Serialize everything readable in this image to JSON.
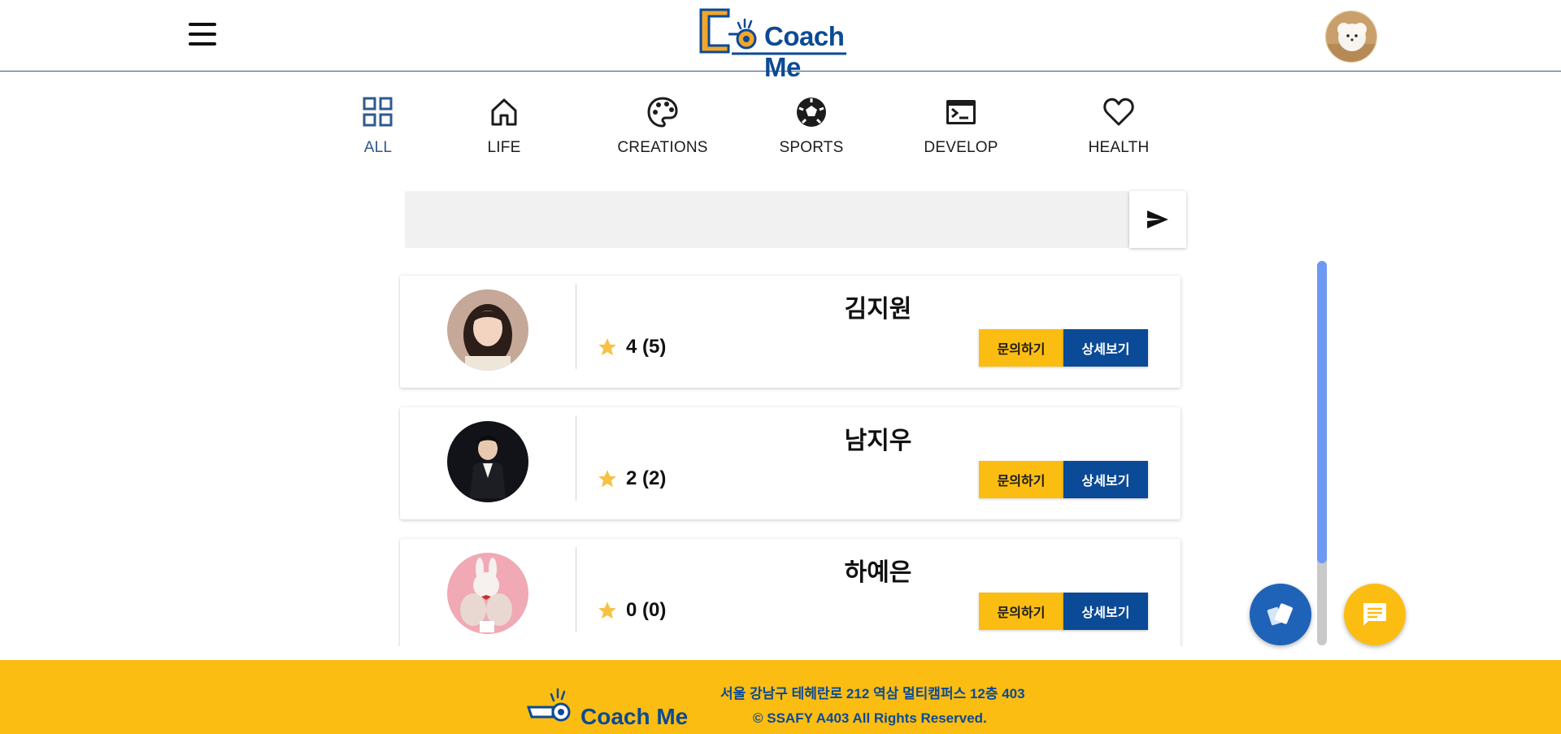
{
  "app": {
    "brand": "Coach Me",
    "logo_icon": "whistle-icon",
    "accent_color": "#0b4a96",
    "highlight_color": "#fbbd12"
  },
  "header": {
    "menu_icon": "hamburger-menu-icon",
    "profile_avatar": "user-avatar"
  },
  "categories": [
    {
      "label": "ALL",
      "icon": "grid-icon",
      "active": true
    },
    {
      "label": "LIFE",
      "icon": "home-icon",
      "active": false
    },
    {
      "label": "CREATIONS",
      "icon": "palette-icon",
      "active": false
    },
    {
      "label": "SPORTS",
      "icon": "soccer-ball-icon",
      "active": false
    },
    {
      "label": "DEVELOP",
      "icon": "terminal-icon",
      "active": false
    },
    {
      "label": "HEALTH",
      "icon": "heart-icon",
      "active": false
    }
  ],
  "search": {
    "value": "",
    "placeholder": "",
    "send_icon": "send-icon"
  },
  "coaches": [
    {
      "name": "김지원",
      "rating_text": "4 (5)",
      "inquiry_label": "문의하기",
      "detail_label": "상세보기"
    },
    {
      "name": "남지우",
      "rating_text": "2 (2)",
      "inquiry_label": "문의하기",
      "detail_label": "상세보기"
    },
    {
      "name": "하예은",
      "rating_text": "0 (0)",
      "inquiry_label": "문의하기",
      "detail_label": "상세보기"
    }
  ],
  "fabs": {
    "cards_icon": "cards-icon",
    "chat_icon": "chat-icon"
  },
  "footer": {
    "brand": "Coach Me",
    "address": "서울 강남구 테헤란로 212 역삼 멀티캠퍼스 12층 403",
    "copyright": "© SSAFY A403 All Rights Reserved."
  }
}
